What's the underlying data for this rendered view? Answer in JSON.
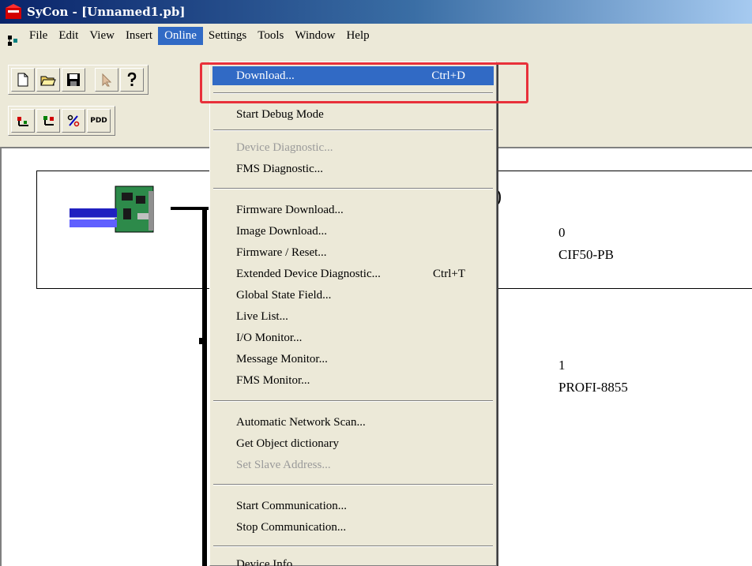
{
  "window": {
    "title": "SyCon - [Unnamed1.pb]"
  },
  "menubar": {
    "items": [
      {
        "label": "File",
        "active": false
      },
      {
        "label": "Edit",
        "active": false
      },
      {
        "label": "View",
        "active": false
      },
      {
        "label": "Insert",
        "active": false
      },
      {
        "label": "Online",
        "active": true
      },
      {
        "label": "Settings",
        "active": false
      },
      {
        "label": "Tools",
        "active": false
      },
      {
        "label": "Window",
        "active": false
      },
      {
        "label": "Help",
        "active": false
      }
    ]
  },
  "toolbar1": {
    "icons": [
      "new-file-icon",
      "open-folder-icon",
      "save-icon",
      "cursor-icon",
      "help-icon"
    ]
  },
  "toolbar2": {
    "icons": [
      "insert-master-icon",
      "insert-slave-icon",
      "percent-icon",
      "pdd-icon"
    ],
    "pdd_label": "PDD"
  },
  "online_menu": {
    "items": [
      {
        "label": "Download...",
        "shortcut": "Ctrl+D",
        "selected": true,
        "disabled": false
      },
      {
        "separator": true
      },
      {
        "label": "Start Debug Mode",
        "disabled": false
      },
      {
        "separator": true
      },
      {
        "label": "Device Diagnostic...",
        "disabled": true
      },
      {
        "label": "FMS Diagnostic...",
        "disabled": false
      },
      {
        "separator": true
      },
      {
        "label": "Firmware Download...",
        "disabled": false
      },
      {
        "label": "Image Download...",
        "disabled": false
      },
      {
        "label": "Firmware / Reset...",
        "disabled": false
      },
      {
        "label": "Extended Device Diagnostic...",
        "shortcut": "Ctrl+T",
        "disabled": false
      },
      {
        "label": "Global State Field...",
        "disabled": false
      },
      {
        "label": "Live List...",
        "disabled": false
      },
      {
        "label": "I/O Monitor...",
        "disabled": false
      },
      {
        "label": "Message Monitor...",
        "disabled": false
      },
      {
        "label": "FMS Monitor...",
        "disabled": false
      },
      {
        "separator": true
      },
      {
        "label": "Automatic Network Scan...",
        "disabled": false
      },
      {
        "label": "Get Object dictionary",
        "disabled": false
      },
      {
        "label": "Set Slave Address...",
        "disabled": true
      },
      {
        "separator": true
      },
      {
        "label": "Start Communication...",
        "disabled": false
      },
      {
        "label": "Stop Communication...",
        "disabled": false
      },
      {
        "separator": true
      },
      {
        "label": "Device Info...",
        "disabled": false
      }
    ]
  },
  "network": {
    "master_suffix": ")",
    "master": {
      "address": "0",
      "name": "CIF50-PB"
    },
    "slave": {
      "address": "1",
      "name": "PROFI-8855"
    }
  },
  "colors": {
    "title_start": "#0a246a",
    "selection": "#316ac5",
    "highlight_box": "#e8303a",
    "chrome": "#ece9d8"
  }
}
